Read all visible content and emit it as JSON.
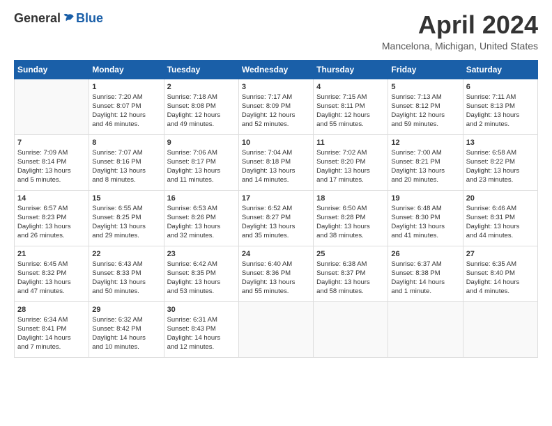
{
  "header": {
    "logo": {
      "general": "General",
      "blue": "Blue"
    },
    "title": "April 2024",
    "location": "Mancelona, Michigan, United States"
  },
  "weekdays": [
    "Sunday",
    "Monday",
    "Tuesday",
    "Wednesday",
    "Thursday",
    "Friday",
    "Saturday"
  ],
  "weeks": [
    [
      {
        "day": "",
        "content": ""
      },
      {
        "day": "1",
        "content": "Sunrise: 7:20 AM\nSunset: 8:07 PM\nDaylight: 12 hours\nand 46 minutes."
      },
      {
        "day": "2",
        "content": "Sunrise: 7:18 AM\nSunset: 8:08 PM\nDaylight: 12 hours\nand 49 minutes."
      },
      {
        "day": "3",
        "content": "Sunrise: 7:17 AM\nSunset: 8:09 PM\nDaylight: 12 hours\nand 52 minutes."
      },
      {
        "day": "4",
        "content": "Sunrise: 7:15 AM\nSunset: 8:11 PM\nDaylight: 12 hours\nand 55 minutes."
      },
      {
        "day": "5",
        "content": "Sunrise: 7:13 AM\nSunset: 8:12 PM\nDaylight: 12 hours\nand 59 minutes."
      },
      {
        "day": "6",
        "content": "Sunrise: 7:11 AM\nSunset: 8:13 PM\nDaylight: 13 hours\nand 2 minutes."
      }
    ],
    [
      {
        "day": "7",
        "content": "Sunrise: 7:09 AM\nSunset: 8:14 PM\nDaylight: 13 hours\nand 5 minutes."
      },
      {
        "day": "8",
        "content": "Sunrise: 7:07 AM\nSunset: 8:16 PM\nDaylight: 13 hours\nand 8 minutes."
      },
      {
        "day": "9",
        "content": "Sunrise: 7:06 AM\nSunset: 8:17 PM\nDaylight: 13 hours\nand 11 minutes."
      },
      {
        "day": "10",
        "content": "Sunrise: 7:04 AM\nSunset: 8:18 PM\nDaylight: 13 hours\nand 14 minutes."
      },
      {
        "day": "11",
        "content": "Sunrise: 7:02 AM\nSunset: 8:20 PM\nDaylight: 13 hours\nand 17 minutes."
      },
      {
        "day": "12",
        "content": "Sunrise: 7:00 AM\nSunset: 8:21 PM\nDaylight: 13 hours\nand 20 minutes."
      },
      {
        "day": "13",
        "content": "Sunrise: 6:58 AM\nSunset: 8:22 PM\nDaylight: 13 hours\nand 23 minutes."
      }
    ],
    [
      {
        "day": "14",
        "content": "Sunrise: 6:57 AM\nSunset: 8:23 PM\nDaylight: 13 hours\nand 26 minutes."
      },
      {
        "day": "15",
        "content": "Sunrise: 6:55 AM\nSunset: 8:25 PM\nDaylight: 13 hours\nand 29 minutes."
      },
      {
        "day": "16",
        "content": "Sunrise: 6:53 AM\nSunset: 8:26 PM\nDaylight: 13 hours\nand 32 minutes."
      },
      {
        "day": "17",
        "content": "Sunrise: 6:52 AM\nSunset: 8:27 PM\nDaylight: 13 hours\nand 35 minutes."
      },
      {
        "day": "18",
        "content": "Sunrise: 6:50 AM\nSunset: 8:28 PM\nDaylight: 13 hours\nand 38 minutes."
      },
      {
        "day": "19",
        "content": "Sunrise: 6:48 AM\nSunset: 8:30 PM\nDaylight: 13 hours\nand 41 minutes."
      },
      {
        "day": "20",
        "content": "Sunrise: 6:46 AM\nSunset: 8:31 PM\nDaylight: 13 hours\nand 44 minutes."
      }
    ],
    [
      {
        "day": "21",
        "content": "Sunrise: 6:45 AM\nSunset: 8:32 PM\nDaylight: 13 hours\nand 47 minutes."
      },
      {
        "day": "22",
        "content": "Sunrise: 6:43 AM\nSunset: 8:33 PM\nDaylight: 13 hours\nand 50 minutes."
      },
      {
        "day": "23",
        "content": "Sunrise: 6:42 AM\nSunset: 8:35 PM\nDaylight: 13 hours\nand 53 minutes."
      },
      {
        "day": "24",
        "content": "Sunrise: 6:40 AM\nSunset: 8:36 PM\nDaylight: 13 hours\nand 55 minutes."
      },
      {
        "day": "25",
        "content": "Sunrise: 6:38 AM\nSunset: 8:37 PM\nDaylight: 13 hours\nand 58 minutes."
      },
      {
        "day": "26",
        "content": "Sunrise: 6:37 AM\nSunset: 8:38 PM\nDaylight: 14 hours\nand 1 minute."
      },
      {
        "day": "27",
        "content": "Sunrise: 6:35 AM\nSunset: 8:40 PM\nDaylight: 14 hours\nand 4 minutes."
      }
    ],
    [
      {
        "day": "28",
        "content": "Sunrise: 6:34 AM\nSunset: 8:41 PM\nDaylight: 14 hours\nand 7 minutes."
      },
      {
        "day": "29",
        "content": "Sunrise: 6:32 AM\nSunset: 8:42 PM\nDaylight: 14 hours\nand 10 minutes."
      },
      {
        "day": "30",
        "content": "Sunrise: 6:31 AM\nSunset: 8:43 PM\nDaylight: 14 hours\nand 12 minutes."
      },
      {
        "day": "",
        "content": ""
      },
      {
        "day": "",
        "content": ""
      },
      {
        "day": "",
        "content": ""
      },
      {
        "day": "",
        "content": ""
      }
    ]
  ]
}
